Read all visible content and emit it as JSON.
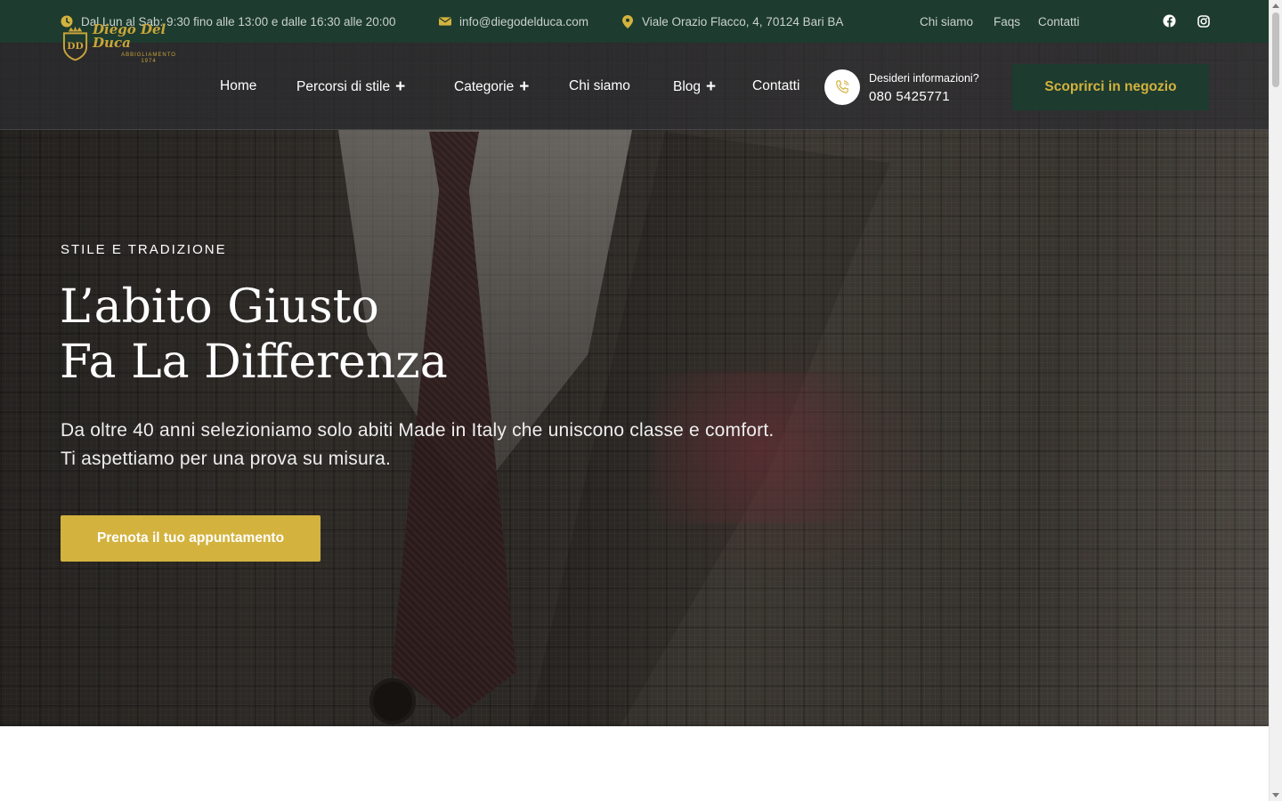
{
  "topbar": {
    "hours": "Dal Lun al Sab: 9:30 fino alle 13:00 e dalle 16:30 alle 20:00",
    "email": "info@diegodelduca.com",
    "address": "Viale Orazio Flacco, 4, 70124 Bari BA",
    "links": [
      "Chi siamo",
      "Faqs",
      "Contatti"
    ],
    "social_icons": [
      "facebook-icon",
      "instagram-icon"
    ],
    "icon_color": "#d3b23e",
    "background": "#1d3b2f"
  },
  "logo": {
    "monogram": "DD",
    "name": "Diego Del Duca",
    "tagline": "ABBIGLIAMENTO",
    "year": "1974"
  },
  "nav": {
    "items": [
      {
        "label": "Home",
        "has_submenu": false
      },
      {
        "label": "Percorsi di stile",
        "has_submenu": true
      },
      {
        "label": "Categorie",
        "has_submenu": true
      },
      {
        "label": "Chi siamo",
        "has_submenu": false
      },
      {
        "label": "Blog",
        "has_submenu": true
      },
      {
        "label": "Contatti",
        "has_submenu": false
      }
    ],
    "submenu_symbol": "+"
  },
  "contact": {
    "question": "Desideri informazioni?",
    "phone": "080 5425771"
  },
  "header_cta": "Scoprirci in negozio",
  "hero": {
    "eyebrow": "STILE E TRADIZIONE",
    "title_line1": "L’abito Giusto",
    "title_line2": "Fa La Differenza",
    "subtitle_line1": "Da oltre 40 anni selezioniamo solo abiti Made in Italy che uniscono classe e comfort.",
    "subtitle_line2": "Ti aspettiamo per una prova su misura.",
    "button": "Prenota il tuo appuntamento"
  },
  "colors": {
    "brand_green": "#1d3b2f",
    "gold": "#d3b23e"
  }
}
